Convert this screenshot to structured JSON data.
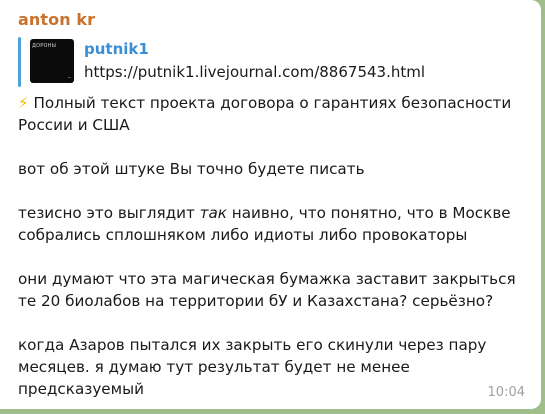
{
  "message": {
    "sender": "anton kr",
    "time": "10:04",
    "link_preview": {
      "thumbnail_caption": "ДОРОНЫ",
      "title": "putnik1",
      "url": "https://putnik1.livejournal.com/8867543.html"
    },
    "paragraphs": {
      "p1": {
        "icon": "⚡",
        "text": " Полный текст проекта договора о гарантиях безопасности России и США"
      },
      "p2": "вот об этой штуке Вы точно будете писать",
      "p3": {
        "before": "тезисно это выглядит ",
        "italic": "так",
        "after": " наивно, что понятно, что в Москве собрались сплошняком либо идиоты либо провокаторы"
      },
      "p4": "они думают что эта магическая бумажка заставит закрыться те 20 биолабов на территории бУ и Казахстана? серьёзно?",
      "p5": "когда Азаров пытался их закрыть его скинули через пару месяцев. я думаю тут результат будет не менее предсказуемый"
    }
  },
  "colors": {
    "background": "#9fbf8a",
    "bubble": "#ffffff",
    "sender": "#c8722b",
    "link": "#3a8ed6",
    "preview_bar": "#4ea4d9",
    "time": "#a0a0a0"
  }
}
